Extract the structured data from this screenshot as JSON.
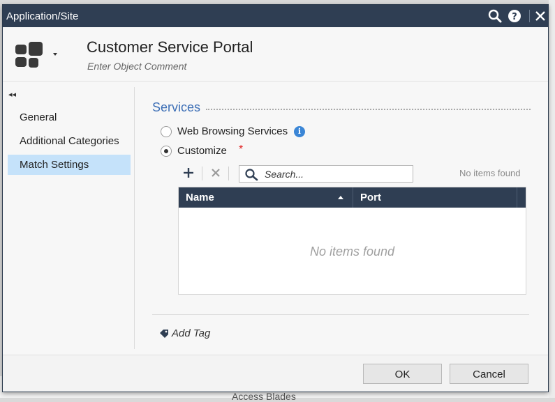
{
  "background": {
    "text": "Access Blades"
  },
  "dialog": {
    "title": "Application/Site",
    "titlebar_icons": [
      "search-icon",
      "help-icon",
      "close-icon"
    ]
  },
  "object": {
    "icon": "application-grid-icon",
    "name": "Customer Service Portal",
    "comment_placeholder": "Enter Object Comment"
  },
  "sidebar": {
    "collapse_icon": "double-chevron-left-icon",
    "items": [
      {
        "label": "General",
        "active": false
      },
      {
        "label": "Additional Categories",
        "active": false
      },
      {
        "label": "Match Settings",
        "active": true
      }
    ]
  },
  "services": {
    "title": "Services",
    "options": [
      {
        "label": "Web Browsing Services",
        "checked": false,
        "info": true
      },
      {
        "label": "Customize",
        "checked": true,
        "required": "*"
      }
    ],
    "toolbar": {
      "add_icon": "plus-icon",
      "remove_icon": "x-icon",
      "search_placeholder": "Search...",
      "status": "No items found"
    },
    "table": {
      "columns": [
        "Name",
        "Port"
      ],
      "sort": "Name ascending",
      "rows": [],
      "empty_message": "No items found"
    }
  },
  "add_tag": {
    "label": "Add Tag",
    "icon": "tag-icon"
  },
  "footer": {
    "ok_label": "OK",
    "cancel_label": "Cancel"
  },
  "colors": {
    "titlebar": "#2f3e53",
    "accent": "#3d6fb6",
    "active_nav": "#c5e2fa",
    "required": "#e02020",
    "info": "#3b86d6"
  }
}
